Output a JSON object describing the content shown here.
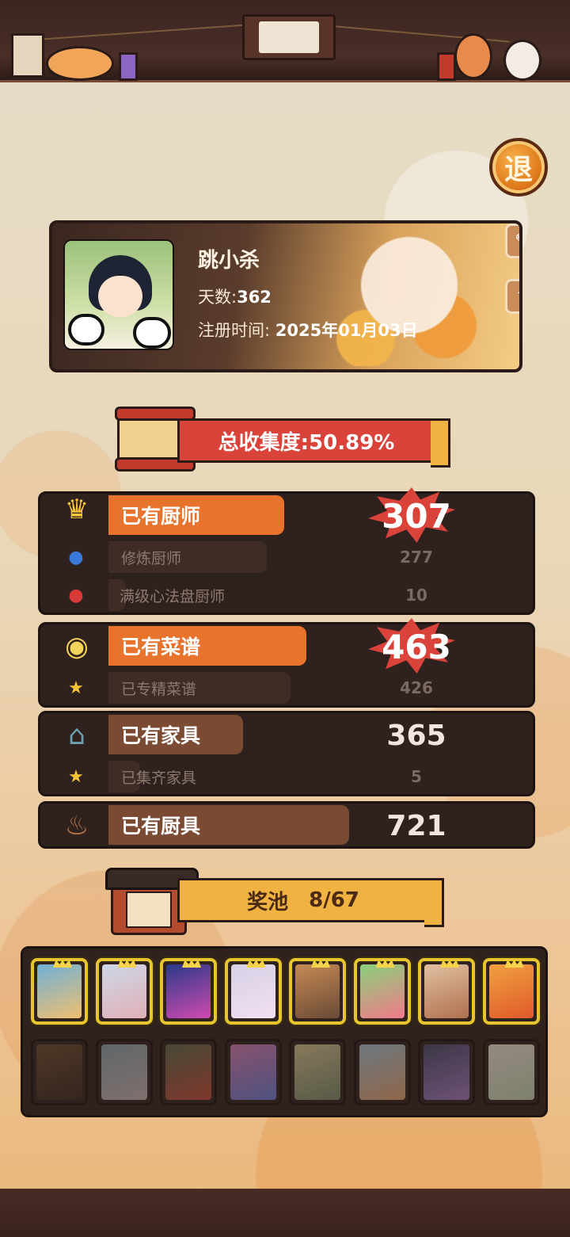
{
  "exit_button": {
    "label": "退"
  },
  "profile": {
    "name": "跳小杀",
    "days_label": "天数:",
    "days_value": "362",
    "register_label": "注册时间:",
    "register_value": "2025年01月03日"
  },
  "collection": {
    "label": "总收集度:50.89%",
    "progress": 0.5089
  },
  "sections": {
    "chefs": {
      "label": "已有厨师",
      "value": "307",
      "fill": 0.45,
      "subs": [
        {
          "label": "修炼厨师",
          "value": "277",
          "fill": 0.4
        },
        {
          "label": "满级心法盘厨师",
          "value": "10",
          "fill": 0.03
        }
      ]
    },
    "recipes": {
      "label": "已有菜谱",
      "value": "463",
      "fill": 0.47,
      "subs": [
        {
          "label": "已专精菜谱",
          "value": "426",
          "fill": 0.43
        }
      ]
    },
    "furniture": {
      "label": "已有家具",
      "value": "365",
      "fill": 0.3,
      "subs": [
        {
          "label": "已集齐家具",
          "value": "5",
          "fill": 0.07
        }
      ]
    },
    "utensils": {
      "label": "已有厨具",
      "value": "721",
      "fill": 0.56
    }
  },
  "prize_pool": {
    "label": "奖池",
    "count": "8/67",
    "unlocked": [
      {
        "colors": [
          "#6fb0d6",
          "#f0c070"
        ]
      },
      {
        "colors": [
          "#cdd7e6",
          "#e0b0b8"
        ]
      },
      {
        "colors": [
          "#2a3a8a",
          "#d04ab0"
        ]
      },
      {
        "colors": [
          "#d8d0e6",
          "#f0e0f0"
        ]
      },
      {
        "colors": [
          "#c68a54",
          "#6a4a36"
        ]
      },
      {
        "colors": [
          "#8ad07a",
          "#f07a8a"
        ]
      },
      {
        "colors": [
          "#e0c0a0",
          "#b07050"
        ]
      },
      {
        "colors": [
          "#f0a040",
          "#e05a2a"
        ]
      }
    ],
    "locked": [
      {
        "colors": [
          "#6a4a30",
          "#3a2a20"
        ]
      },
      {
        "colors": [
          "#8aa0a8",
          "#c0b0b0"
        ]
      },
      {
        "colors": [
          "#5a6a4a",
          "#c04a3a"
        ]
      },
      {
        "colors": [
          "#d07ab0",
          "#6a7ad0"
        ]
      },
      {
        "colors": [
          "#d0c090",
          "#7a8a6a"
        ]
      },
      {
        "colors": [
          "#a0c0d0",
          "#e0a070"
        ]
      },
      {
        "colors": [
          "#4a4a6a",
          "#a07ac0"
        ]
      },
      {
        "colors": [
          "#e8e0d0",
          "#c0d0b0"
        ]
      }
    ]
  },
  "icons": {
    "edit": "edit-icon",
    "share": "share-icon",
    "chef": "chef-icon",
    "pudding": "pudding-icon",
    "furniture": "furniture-icon",
    "utensil": "utensil-icon",
    "star": "star-icon"
  },
  "colors": {
    "accent_orange": "#e8732c",
    "banner_red": "#d9433a",
    "banner_gold": "#f0b240",
    "panel_dark": "#2f211d"
  }
}
